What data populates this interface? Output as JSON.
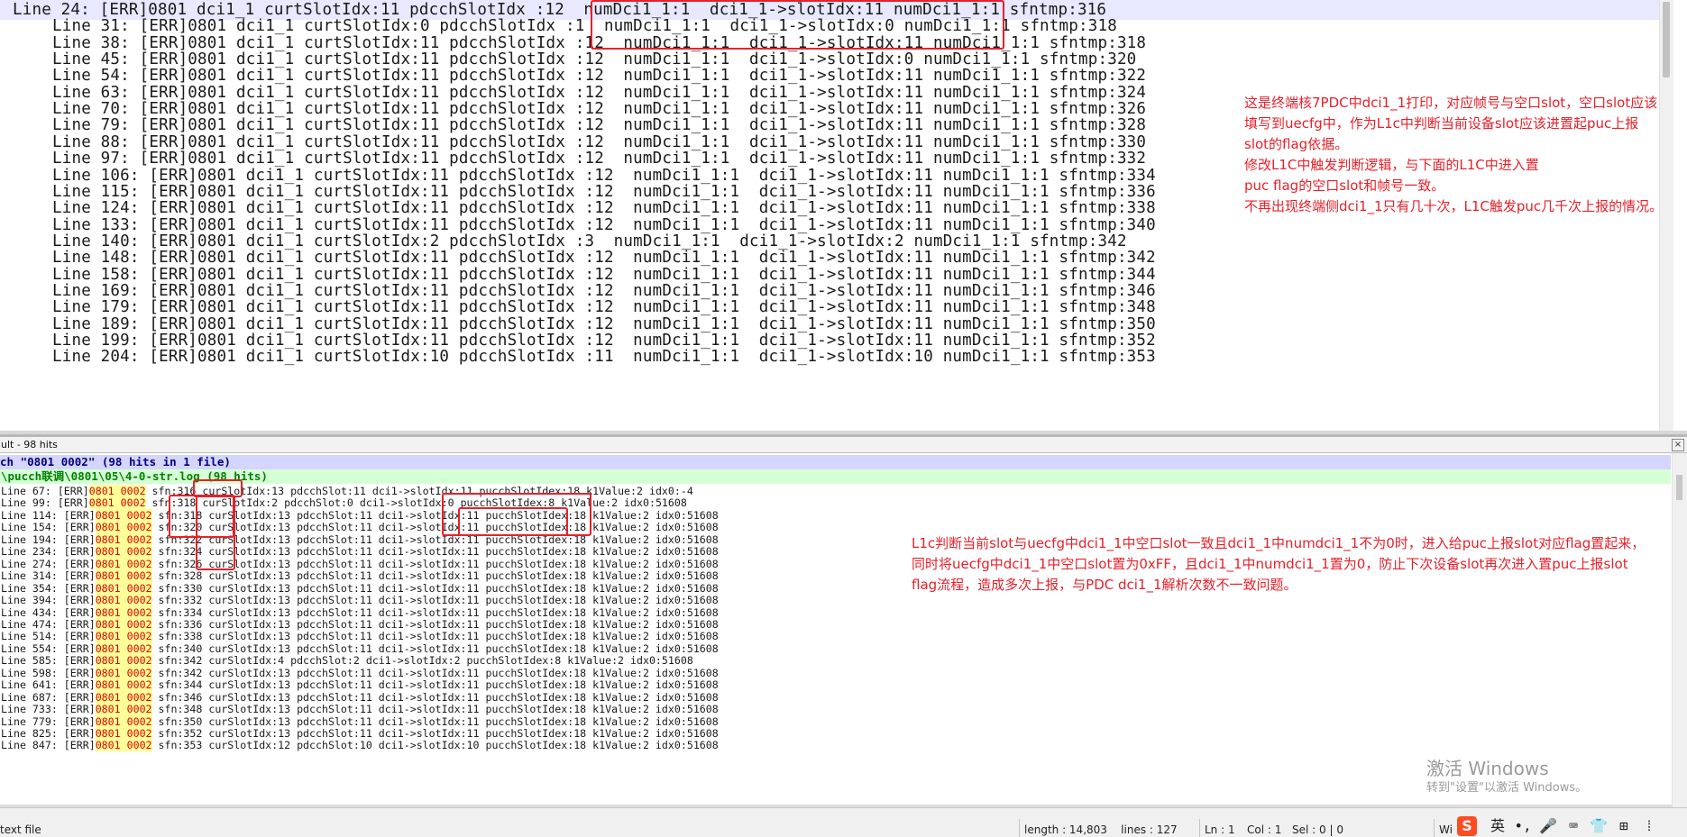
{
  "top_editor": {
    "lines": [
      {
        "text": "Line 24: [ERR]0801 dci1_1 curtSlotIdx:11 pdcchSlotIdx :12  numDci1_1:1  dci1_1->slotIdx:11 numDci1_1:1 sfntmp:316"
      },
      {
        "text": "Line 31: [ERR]0801 dci1_1 curtSlotIdx:0 pdcchSlotIdx :1  numDci1_1:1  dci1_1->slotIdx:0 numDci1_1:1 sfntmp:318"
      },
      {
        "text": "Line 38: [ERR]0801 dci1_1 curtSlotIdx:11 pdcchSlotIdx :12  numDci1_1:1  dci1_1->slotIdx:11 numDci1_1:1 sfntmp:318"
      },
      {
        "text": "Line 45: [ERR]0801 dci1_1 curtSlotIdx:11 pdcchSlotIdx :12  numDci1_1:1  dci1_1->slotIdx:0 numDci1_1:1 sfntmp:320"
      },
      {
        "text": "Line 54: [ERR]0801 dci1_1 curtSlotIdx:11 pdcchSlotIdx :12  numDci1_1:1  dci1_1->slotIdx:11 numDci1_1:1 sfntmp:322"
      },
      {
        "text": "Line 63: [ERR]0801 dci1_1 curtSlotIdx:11 pdcchSlotIdx :12  numDci1_1:1  dci1_1->slotIdx:11 numDci1_1:1 sfntmp:324"
      },
      {
        "text": "Line 70: [ERR]0801 dci1_1 curtSlotIdx:11 pdcchSlotIdx :12  numDci1_1:1  dci1_1->slotIdx:11 numDci1_1:1 sfntmp:326"
      },
      {
        "text": "Line 79: [ERR]0801 dci1_1 curtSlotIdx:11 pdcchSlotIdx :12  numDci1_1:1  dci1_1->slotIdx:11 numDci1_1:1 sfntmp:328"
      },
      {
        "text": "Line 88: [ERR]0801 dci1_1 curtSlotIdx:11 pdcchSlotIdx :12  numDci1_1:1  dci1_1->slotIdx:11 numDci1_1:1 sfntmp:330"
      },
      {
        "text": "Line 97: [ERR]0801 dci1_1 curtSlotIdx:11 pdcchSlotIdx :12  numDci1_1:1  dci1_1->slotIdx:11 numDci1_1:1 sfntmp:332"
      },
      {
        "text": "Line 106: [ERR]0801 dci1_1 curtSlotIdx:11 pdcchSlotIdx :12  numDci1_1:1  dci1_1->slotIdx:11 numDci1_1:1 sfntmp:334"
      },
      {
        "text": "Line 115: [ERR]0801 dci1_1 curtSlotIdx:11 pdcchSlotIdx :12  numDci1_1:1  dci1_1->slotIdx:11 numDci1_1:1 sfntmp:336"
      },
      {
        "text": "Line 124: [ERR]0801 dci1_1 curtSlotIdx:11 pdcchSlotIdx :12  numDci1_1:1  dci1_1->slotIdx:11 numDci1_1:1 sfntmp:338"
      },
      {
        "text": "Line 133: [ERR]0801 dci1_1 curtSlotIdx:11 pdcchSlotIdx :12  numDci1_1:1  dci1_1->slotIdx:11 numDci1_1:1 sfntmp:340"
      },
      {
        "text": "Line 140: [ERR]0801 dci1_1 curtSlotIdx:2 pdcchSlotIdx :3  numDci1_1:1  dci1_1->slotIdx:2 numDci1_1:1 sfntmp:342"
      },
      {
        "text": "Line 148: [ERR]0801 dci1_1 curtSlotIdx:11 pdcchSlotIdx :12  numDci1_1:1  dci1_1->slotIdx:11 numDci1_1:1 sfntmp:342"
      },
      {
        "text": "Line 158: [ERR]0801 dci1_1 curtSlotIdx:11 pdcchSlotIdx :12  numDci1_1:1  dci1_1->slotIdx:11 numDci1_1:1 sfntmp:344"
      },
      {
        "text": "Line 169: [ERR]0801 dci1_1 curtSlotIdx:11 pdcchSlotIdx :12  numDci1_1:1  dci1_1->slotIdx:11 numDci1_1:1 sfntmp:346"
      },
      {
        "text": "Line 179: [ERR]0801 dci1_1 curtSlotIdx:11 pdcchSlotIdx :12  numDci1_1:1  dci1_1->slotIdx:11 numDci1_1:1 sfntmp:348"
      },
      {
        "text": "Line 189: [ERR]0801 dci1_1 curtSlotIdx:11 pdcchSlotIdx :12  numDci1_1:1  dci1_1->slotIdx:11 numDci1_1:1 sfntmp:350"
      },
      {
        "text": "Line 199: [ERR]0801 dci1_1 curtSlotIdx:11 pdcchSlotIdx :12  numDci1_1:1  dci1_1->slotIdx:11 numDci1_1:1 sfntmp:352"
      },
      {
        "text": "Line 204: [ERR]0801 dci1_1 curtSlotIdx:10 pdcchSlotIdx :11  numDci1_1:1  dci1_1->slotIdx:10 numDci1_1:1 sfntmp:353"
      }
    ],
    "annotation": "这是终端核7PDC中dci1_1打印，对应帧号与空口slot，空口slot应该\n填写到uecfg中，作为L1c中判断当前设备slot应该进置起puc上报\nslot的flag依据。\n修改L1C中触发判断逻辑，与下面的L1C中进入置\npuc flag的空口slot和帧号一致。\n不再出现终端侧dci1_1只有几十次，L1C触发puc几千次上报的情况。"
  },
  "results": {
    "title": "ult - 98 hits",
    "close_label": "×",
    "search_header": "ch \"0801 0002\" (98 hits in 1 file)",
    "file_header": "\\pucch联调\\0801\\05\\4-0-str.log (98 hits)",
    "hit_text": "0801 0002",
    "rows": [
      {
        "prefix": "Line 67: [ERR]",
        "rest": " sfn:316 curSlotIdx:13 pdcchSlot:11 dci1->slotIdx:11 pucchSlotIdex:18 k1Value:2 idx0:-4"
      },
      {
        "prefix": "Line 99: [ERR]",
        "rest": " sfn:318 curSlotIdx:2 pdcchSlot:0 dci1->slotIdx:0 pucchSlotIdex:8 k1Value:2 idx0:51608"
      },
      {
        "prefix": "Line 114: [ERR]",
        "rest": " sfn:318 curSlotIdx:13 pdcchSlot:11 dci1->slotIdx:11 pucchSlotIdex:18 k1Value:2 idx0:51608"
      },
      {
        "prefix": "Line 154: [ERR]",
        "rest": " sfn:320 curSlotIdx:13 pdcchSlot:11 dci1->slotIdx:11 pucchSlotIdex:18 k1Value:2 idx0:51608"
      },
      {
        "prefix": "Line 194: [ERR]",
        "rest": " sfn:322 curSlotIdx:13 pdcchSlot:11 dci1->slotIdx:11 pucchSlotIdex:18 k1Value:2 idx0:51608"
      },
      {
        "prefix": "Line 234: [ERR]",
        "rest": " sfn:324 curSlotIdx:13 pdcchSlot:11 dci1->slotIdx:11 pucchSlotIdex:18 k1Value:2 idx0:51608"
      },
      {
        "prefix": "Line 274: [ERR]",
        "rest": " sfn:326 curSlotIdx:13 pdcchSlot:11 dci1->slotIdx:11 pucchSlotIdex:18 k1Value:2 idx0:51608"
      },
      {
        "prefix": "Line 314: [ERR]",
        "rest": " sfn:328 curSlotIdx:13 pdcchSlot:11 dci1->slotIdx:11 pucchSlotIdex:18 k1Value:2 idx0:51608"
      },
      {
        "prefix": "Line 354: [ERR]",
        "rest": " sfn:330 curSlotIdx:13 pdcchSlot:11 dci1->slotIdx:11 pucchSlotIdex:18 k1Value:2 idx0:51608"
      },
      {
        "prefix": "Line 394: [ERR]",
        "rest": " sfn:332 curSlotIdx:13 pdcchSlot:11 dci1->slotIdx:11 pucchSlotIdex:18 k1Value:2 idx0:51608"
      },
      {
        "prefix": "Line 434: [ERR]",
        "rest": " sfn:334 curSlotIdx:13 pdcchSlot:11 dci1->slotIdx:11 pucchSlotIdex:18 k1Value:2 idx0:51608"
      },
      {
        "prefix": "Line 474: [ERR]",
        "rest": " sfn:336 curSlotIdx:13 pdcchSlot:11 dci1->slotIdx:11 pucchSlotIdex:18 k1Value:2 idx0:51608"
      },
      {
        "prefix": "Line 514: [ERR]",
        "rest": " sfn:338 curSlotIdx:13 pdcchSlot:11 dci1->slotIdx:11 pucchSlotIdex:18 k1Value:2 idx0:51608"
      },
      {
        "prefix": "Line 554: [ERR]",
        "rest": " sfn:340 curSlotIdx:13 pdcchSlot:11 dci1->slotIdx:11 pucchSlotIdex:18 k1Value:2 idx0:51608"
      },
      {
        "prefix": "Line 585: [ERR]",
        "rest": " sfn:342 curSlotIdx:4 pdcchSlot:2 dci1->slotIdx:2 pucchSlotIdex:8 k1Value:2 idx0:51608"
      },
      {
        "prefix": "Line 598: [ERR]",
        "rest": " sfn:342 curSlotIdx:13 pdcchSlot:11 dci1->slotIdx:11 pucchSlotIdex:18 k1Value:2 idx0:51608"
      },
      {
        "prefix": "Line 641: [ERR]",
        "rest": " sfn:344 curSlotIdx:13 pdcchSlot:11 dci1->slotIdx:11 pucchSlotIdex:18 k1Value:2 idx0:51608"
      },
      {
        "prefix": "Line 687: [ERR]",
        "rest": " sfn:346 curSlotIdx:13 pdcchSlot:11 dci1->slotIdx:11 pucchSlotIdex:18 k1Value:2 idx0:51608"
      },
      {
        "prefix": "Line 733: [ERR]",
        "rest": " sfn:348 curSlotIdx:13 pdcchSlot:11 dci1->slotIdx:11 pucchSlotIdex:18 k1Value:2 idx0:51608"
      },
      {
        "prefix": "Line 779: [ERR]",
        "rest": " sfn:350 curSlotIdx:13 pdcchSlot:11 dci1->slotIdx:11 pucchSlotIdex:18 k1Value:2 idx0:51608"
      },
      {
        "prefix": "Line 825: [ERR]",
        "rest": " sfn:352 curSlotIdx:13 pdcchSlot:11 dci1->slotIdx:11 pucchSlotIdex:18 k1Value:2 idx0:51608"
      },
      {
        "prefix": "Line 847: [ERR]",
        "rest": " sfn:353 curSlotIdx:12 pdcchSlot:10 dci1->slotIdx:10 pucchSlotIdex:18 k1Value:2 idx0:51608"
      }
    ],
    "annotation": "L1c判断当前slot与uecfg中dci1_1中空口slot一致且dci1_1中numdci1_1不为0时，进入给puc上报slot对应flag置起来，\n同时将uecfg中dci1_1中空口slot置为0xFF，且dci1_1中numdci1_1置为0，防止下次设备slot再次进入置puc上报slot\nflag流程，造成多次上报，与PDC dci1_1解析次数不一致问题。"
  },
  "watermark": {
    "title": "激活 Windows",
    "subtitle": "转到\"设置\"以激活 Windows。"
  },
  "statusbar": {
    "filetype": "text file",
    "length": "length : 14,803    lines : 127",
    "ln": "Ln : 1",
    "col": "Col : 1",
    "sel": "Sel : 0 | 0",
    "win": "Wi"
  },
  "ime": {
    "sogou": "S",
    "lang": "英",
    "punct": "•,",
    "mic": "🎤",
    "keyboard": "⌨",
    "skin": "👕",
    "tools": "⊞",
    "more": "⁞"
  },
  "colors": {
    "annotation_red": "#e8202a",
    "hit_background": "#ffff99",
    "hit_text": "#e30000",
    "search_header_bg": "#d5d5ff",
    "file_header_bg": "#d5ffd5"
  }
}
